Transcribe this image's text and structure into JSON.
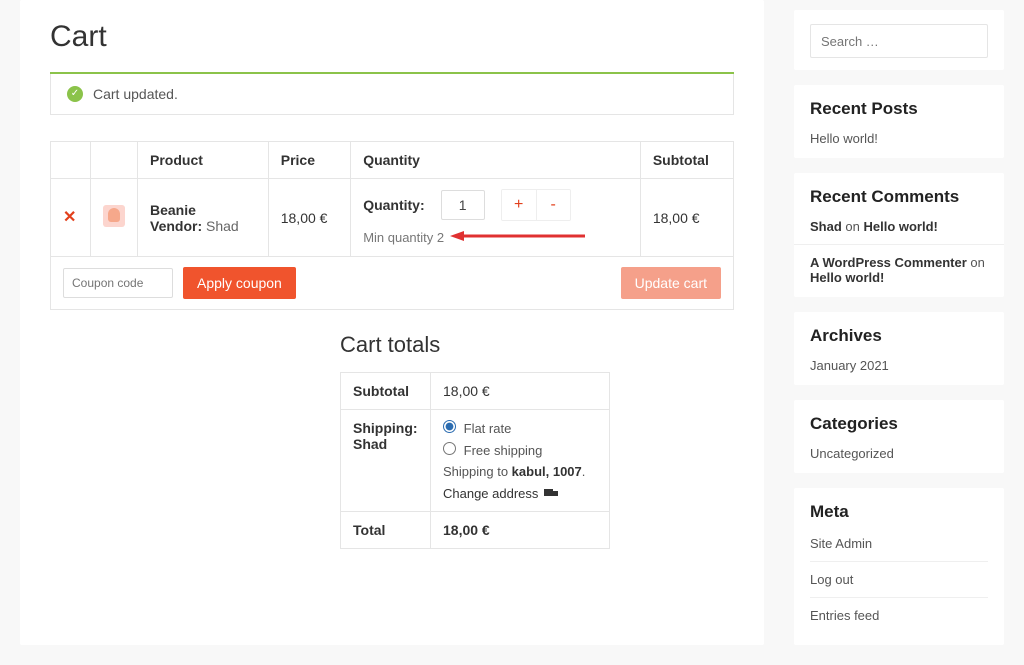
{
  "page": {
    "title": "Cart",
    "notice": "Cart updated."
  },
  "cart": {
    "headers": {
      "product": "Product",
      "price": "Price",
      "quantity": "Quantity",
      "subtotal": "Subtotal"
    },
    "row": {
      "product_name": "Beanie",
      "vendor_label": "Vendor:",
      "vendor_name": "Shad",
      "price": "18,00 €",
      "qty_label": "Quantity:",
      "qty_value": "1",
      "min_qty": "Min quantity 2",
      "subtotal": "18,00 €"
    },
    "coupon_placeholder": "Coupon code",
    "apply_coupon": "Apply coupon",
    "update_cart": "Update cart"
  },
  "totals": {
    "title": "Cart totals",
    "subtotal_label": "Subtotal",
    "subtotal_value": "18,00 €",
    "shipping_label": "Shipping: Shad",
    "flat_rate": "Flat rate",
    "free_shipping": "Free shipping",
    "shipping_to_prefix": "Shipping to ",
    "shipping_to_dest": "kabul, 1007",
    "change_address": "Change address",
    "total_label": "Total",
    "total_value": "18,00 €"
  },
  "sidebar": {
    "search_placeholder": "Search …",
    "recent_posts": {
      "title": "Recent Posts",
      "items": [
        "Hello world!"
      ]
    },
    "recent_comments": {
      "title": "Recent Comments",
      "items": [
        {
          "author": "Shad",
          "on": " on ",
          "post": "Hello world!"
        },
        {
          "author": "A WordPress Commenter",
          "on": " on ",
          "post": "Hello world!"
        }
      ]
    },
    "archives": {
      "title": "Archives",
      "items": [
        "January 2021"
      ]
    },
    "categories": {
      "title": "Categories",
      "items": [
        "Uncategorized"
      ]
    },
    "meta": {
      "title": "Meta",
      "items": [
        "Site Admin",
        "Log out",
        "Entries feed"
      ]
    }
  }
}
